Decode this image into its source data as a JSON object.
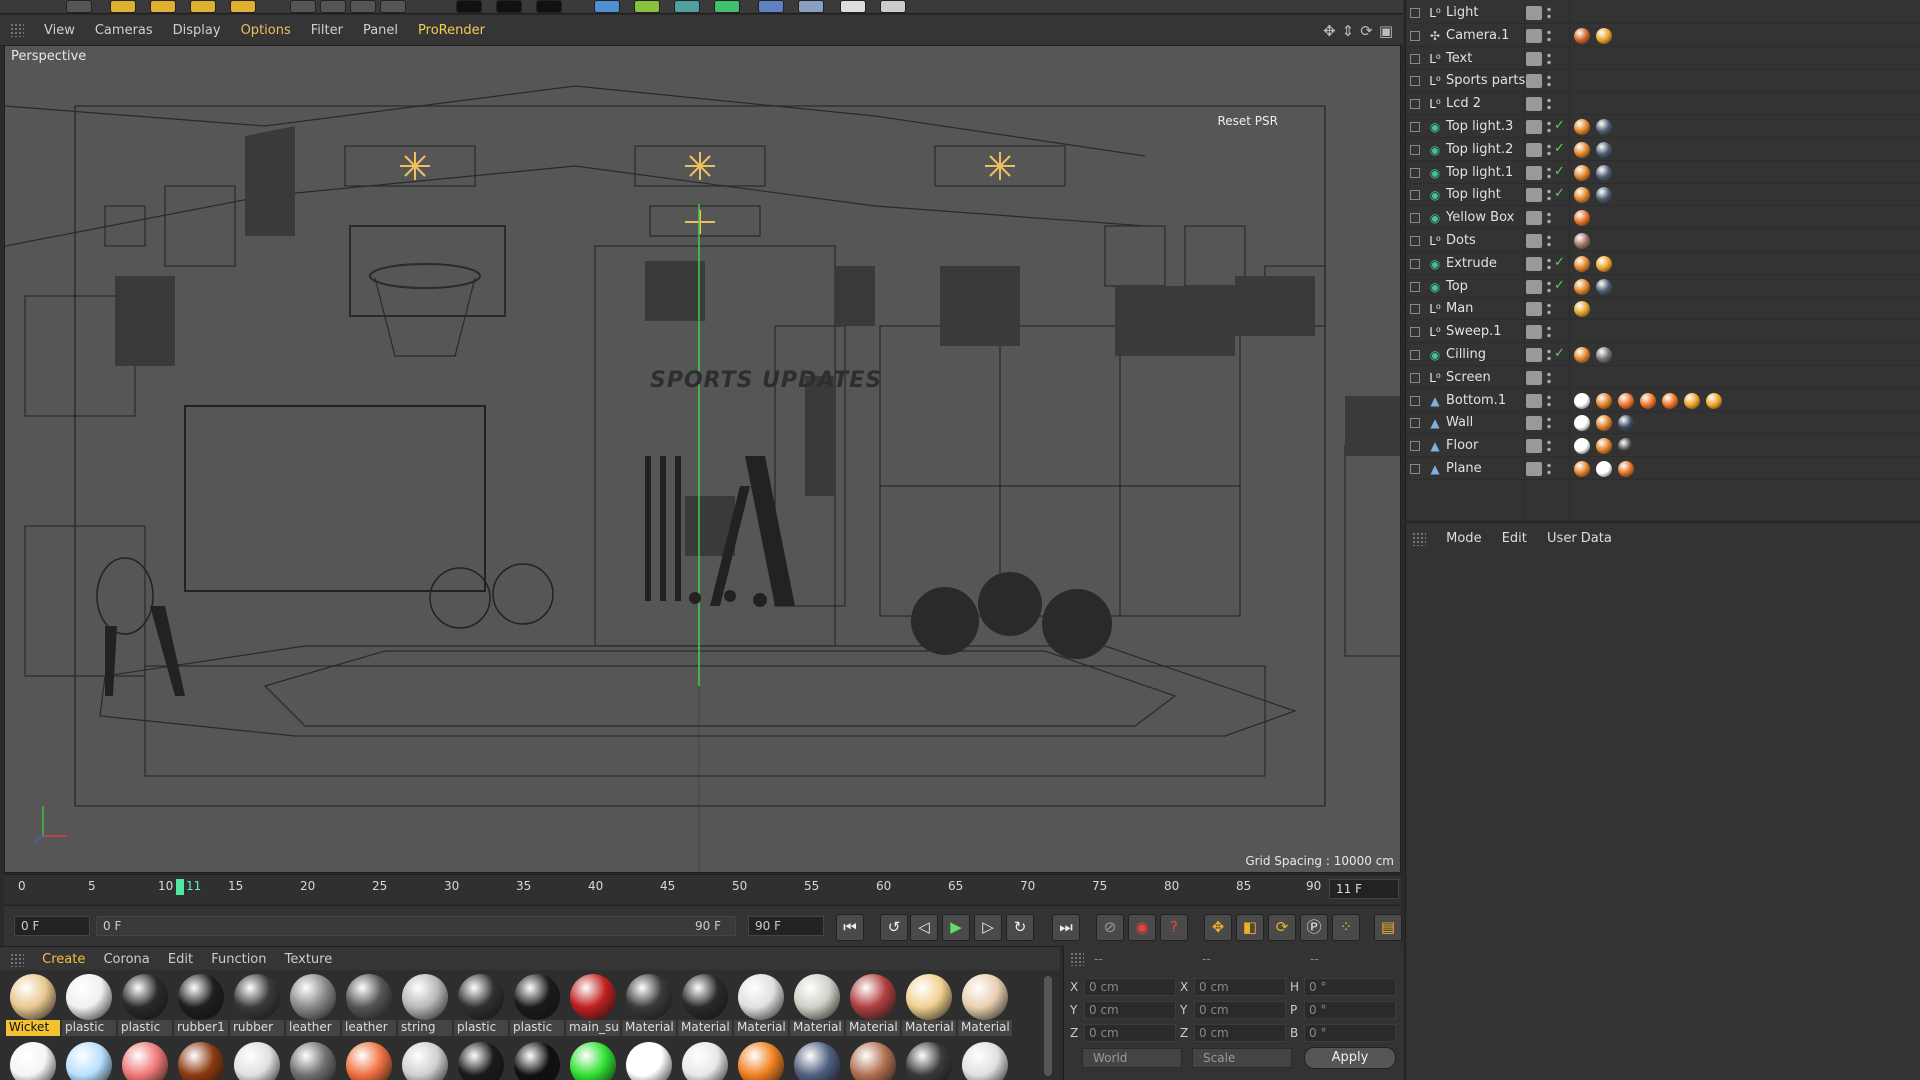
{
  "viewport": {
    "menu": [
      "View",
      "Cameras",
      "Display",
      "Options",
      "Filter",
      "Panel",
      "ProRender"
    ],
    "label": "Perspective",
    "reset_psr": "Reset PSR",
    "grid_spacing": "Grid Spacing : 10000 cm",
    "scene_text": "SPORTS UPDATES"
  },
  "timeline": {
    "ticks": [
      "0",
      "5",
      "10",
      "11",
      "15",
      "20",
      "25",
      "30",
      "35",
      "40",
      "45",
      "50",
      "55",
      "60",
      "65",
      "70",
      "75",
      "80",
      "85",
      "90"
    ],
    "current_frame": "11 F"
  },
  "transport": {
    "start_field": "0 F",
    "range_start": "0 F",
    "range_end": "90 F",
    "end_field": "90 F"
  },
  "materials": {
    "menu": [
      "Create",
      "Corona",
      "Edit",
      "Function",
      "Texture"
    ],
    "row1": [
      {
        "name": "Wicket",
        "color": "#e8c890"
      },
      {
        "name": "plastic",
        "color": "#f0f0f0"
      },
      {
        "name": "plastic",
        "color": "#2a2a2a"
      },
      {
        "name": "rubber1",
        "color": "#1e1e1e"
      },
      {
        "name": "rubber",
        "color": "#3a3a3a"
      },
      {
        "name": "leather",
        "color": "#8a8a8a"
      },
      {
        "name": "leather",
        "color": "#555555"
      },
      {
        "name": "string",
        "color": "#b8b8b8"
      },
      {
        "name": "plastic",
        "color": "#303030"
      },
      {
        "name": "plastic",
        "color": "#1a1a1a"
      },
      {
        "name": "main_su",
        "color": "#c02020"
      },
      {
        "name": "Material",
        "color": "#3a3a3a"
      },
      {
        "name": "Material",
        "color": "#2a2a2a"
      },
      {
        "name": "Material",
        "color": "#e0e0e0"
      },
      {
        "name": "Material",
        "color": "#d0d0c8"
      },
      {
        "name": "Material",
        "color": "#b04040"
      },
      {
        "name": "Material",
        "color": "#f0d090"
      },
      {
        "name": "Material",
        "color": "#e8d0b0"
      }
    ],
    "row2": [
      "#f5f5f5",
      "#b8e0ff",
      "#f07878",
      "#8a3a10",
      "#e0e0e0",
      "#707070",
      "#f07040",
      "#d0d0d0",
      "#1a1a1a",
      "#101010",
      "#30e030",
      "#ffffff",
      "#e8e8e8",
      "#f08020",
      "#506080",
      "#b07050",
      "#3a3a3a",
      "#e0e0e0"
    ]
  },
  "coordinates": {
    "headers": [
      "--",
      "--",
      "--"
    ],
    "rows": [
      {
        "a": "X",
        "av": "0 cm",
        "b": "X",
        "bv": "0 cm",
        "c": "H",
        "cv": "0 °"
      },
      {
        "a": "Y",
        "av": "0 cm",
        "b": "Y",
        "bv": "0 cm",
        "c": "P",
        "cv": "0 °"
      },
      {
        "a": "Z",
        "av": "0 cm",
        "b": "Z",
        "bv": "0 cm",
        "c": "B",
        "cv": "0 °"
      }
    ],
    "world": "World",
    "scale": "Scale",
    "apply": "Apply"
  },
  "objects": [
    {
      "name": "Light",
      "icon": "null",
      "check": false,
      "tags": []
    },
    {
      "name": "Camera.1",
      "icon": "camera",
      "check": false,
      "tags": [
        "#d06020",
        "#e8a020"
      ]
    },
    {
      "name": "Text",
      "icon": "null",
      "check": false,
      "tags": []
    },
    {
      "name": "Sports parts",
      "icon": "null",
      "check": false,
      "tags": []
    },
    {
      "name": "Lcd 2",
      "icon": "null",
      "check": false,
      "tags": []
    },
    {
      "name": "Top light.3",
      "icon": "gen",
      "check": true,
      "tags": [
        "#e08020",
        "#4a5a70"
      ]
    },
    {
      "name": "Top light.2",
      "icon": "gen",
      "check": true,
      "tags": [
        "#e08020",
        "#4a5a70"
      ]
    },
    {
      "name": "Top light.1",
      "icon": "gen",
      "check": true,
      "tags": [
        "#e08020",
        "#4a5a70"
      ]
    },
    {
      "name": "Top light",
      "icon": "gen",
      "check": true,
      "tags": [
        "#e08020",
        "#4a5a70"
      ]
    },
    {
      "name": "Yellow Box",
      "icon": "gen",
      "check": false,
      "tags": [
        "#e07020"
      ]
    },
    {
      "name": "Dots",
      "icon": "null",
      "check": false,
      "tags": [
        "#a07060"
      ]
    },
    {
      "name": "Extrude",
      "icon": "gen",
      "check": true,
      "tags": [
        "#e08020",
        "#f0a020"
      ]
    },
    {
      "name": "Top",
      "icon": "gen",
      "check": true,
      "tags": [
        "#e08020",
        "#4a5a70"
      ]
    },
    {
      "name": "Man",
      "icon": "null",
      "check": false,
      "tags": [
        "#e0a020"
      ]
    },
    {
      "name": "Sweep.1",
      "icon": "null",
      "check": false,
      "tags": []
    },
    {
      "name": "Cilling",
      "icon": "gen",
      "check": true,
      "tags": [
        "#e08020",
        "#707070"
      ]
    },
    {
      "name": "Screen",
      "icon": "null",
      "check": false,
      "tags": []
    },
    {
      "name": "Bottom.1",
      "icon": "poly",
      "check": false,
      "tags": [
        "#ffffff",
        "#e08020",
        "#f07020",
        "#f07020",
        "#f07020",
        "#f0a020",
        "#f0a020"
      ]
    },
    {
      "name": "Wall",
      "icon": "poly",
      "check": false,
      "tags": [
        "#ffffff",
        "#e08020",
        "#3a4a60"
      ]
    },
    {
      "name": "Floor",
      "icon": "poly",
      "check": false,
      "tags": [
        "#ffffff",
        "#e08020",
        "#3a3a3a"
      ]
    },
    {
      "name": "Plane",
      "icon": "poly",
      "check": false,
      "tags": [
        "#e08020",
        "#ffffff",
        "#e07020"
      ]
    }
  ],
  "attributes": {
    "menu": [
      "Mode",
      "Edit",
      "User Data"
    ]
  }
}
